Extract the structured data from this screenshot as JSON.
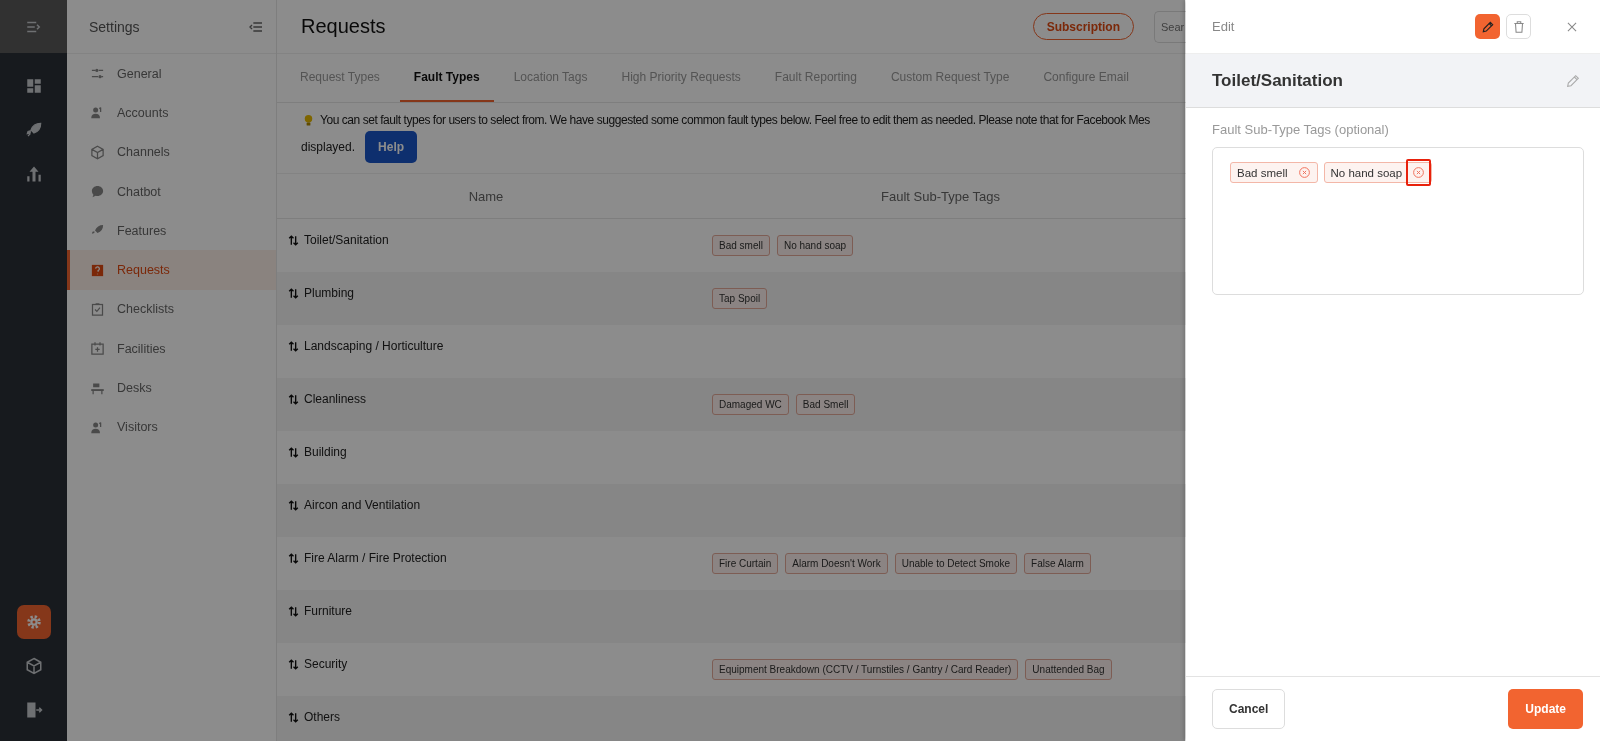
{
  "rail": {
    "top_items": [
      {
        "kind": "menu",
        "selected": false
      },
      {
        "kind": "dashboard",
        "selected": false
      },
      {
        "kind": "rocket",
        "selected": false
      },
      {
        "kind": "chart",
        "selected": false
      }
    ],
    "bottom_items": [
      {
        "kind": "gear",
        "selected": true
      },
      {
        "kind": "cube",
        "selected": false
      },
      {
        "kind": "exit",
        "selected": false
      }
    ]
  },
  "settings_sidebar": {
    "title": "Settings",
    "items": [
      {
        "label": "General",
        "selected": false
      },
      {
        "label": "Accounts",
        "selected": false
      },
      {
        "label": "Channels",
        "selected": false
      },
      {
        "label": "Chatbot",
        "selected": false
      },
      {
        "label": "Features",
        "selected": false
      },
      {
        "label": "Requests",
        "selected": true
      },
      {
        "label": "Checklists",
        "selected": false
      },
      {
        "label": "Facilities",
        "selected": false
      },
      {
        "label": "Desks",
        "selected": false
      },
      {
        "label": "Visitors",
        "selected": false
      }
    ]
  },
  "header": {
    "title": "Requests",
    "subscription_button": "Subscription",
    "search": {
      "placeholder": "Sear"
    }
  },
  "tabs": [
    {
      "label": "Request Types",
      "selected": false
    },
    {
      "label": "Fault Types",
      "selected": true
    },
    {
      "label": "Location Tags",
      "selected": false
    },
    {
      "label": "High Priority Requests",
      "selected": false
    },
    {
      "label": "Fault Reporting",
      "selected": false
    },
    {
      "label": "Custom Request Type",
      "selected": false
    },
    {
      "label": "Configure Email",
      "selected": false
    }
  ],
  "notice": {
    "text": "You can set fault types for users to select from. We have suggested some common fault types below. Feel free to edit them as needed. Please note that for Facebook Mes",
    "text_2": "displayed.",
    "help_button": "Help"
  },
  "table": {
    "columns": [
      "Name",
      "Fault Sub-Type Tags"
    ],
    "rows": [
      {
        "name": "Toilet/Sanitation",
        "tags": [
          "Bad smell",
          "No hand soap"
        ]
      },
      {
        "name": "Plumbing",
        "tags": [
          "Tap Spoil"
        ]
      },
      {
        "name": "Landscaping / Horticulture",
        "tags": []
      },
      {
        "name": "Cleanliness",
        "tags": [
          "Damaged WC",
          "Bad Smell"
        ]
      },
      {
        "name": "Building",
        "tags": []
      },
      {
        "name": "Aircon and Ventilation",
        "tags": []
      },
      {
        "name": "Fire Alarm / Fire Protection",
        "tags": [
          "Fire Curtain",
          "Alarm Doesn't Work",
          "Unable to Detect Smoke",
          "False Alarm"
        ]
      },
      {
        "name": "Furniture",
        "tags": []
      },
      {
        "name": "Security",
        "tags": [
          "Equipment Breakdown (CCTV / Turnstiles / Gantry / Card Reader)",
          "Unattended Bag"
        ]
      },
      {
        "name": "Others",
        "tags": []
      }
    ]
  },
  "drawer": {
    "title": "Edit",
    "heading": "Toilet/Sanitation",
    "field_label": "Fault Sub-Type Tags (optional)",
    "tags": [
      {
        "label": "Bad smell",
        "highlighted": false
      },
      {
        "label": "No hand soap",
        "highlighted": true
      }
    ],
    "cancel_button": "Cancel",
    "update_button": "Update"
  }
}
